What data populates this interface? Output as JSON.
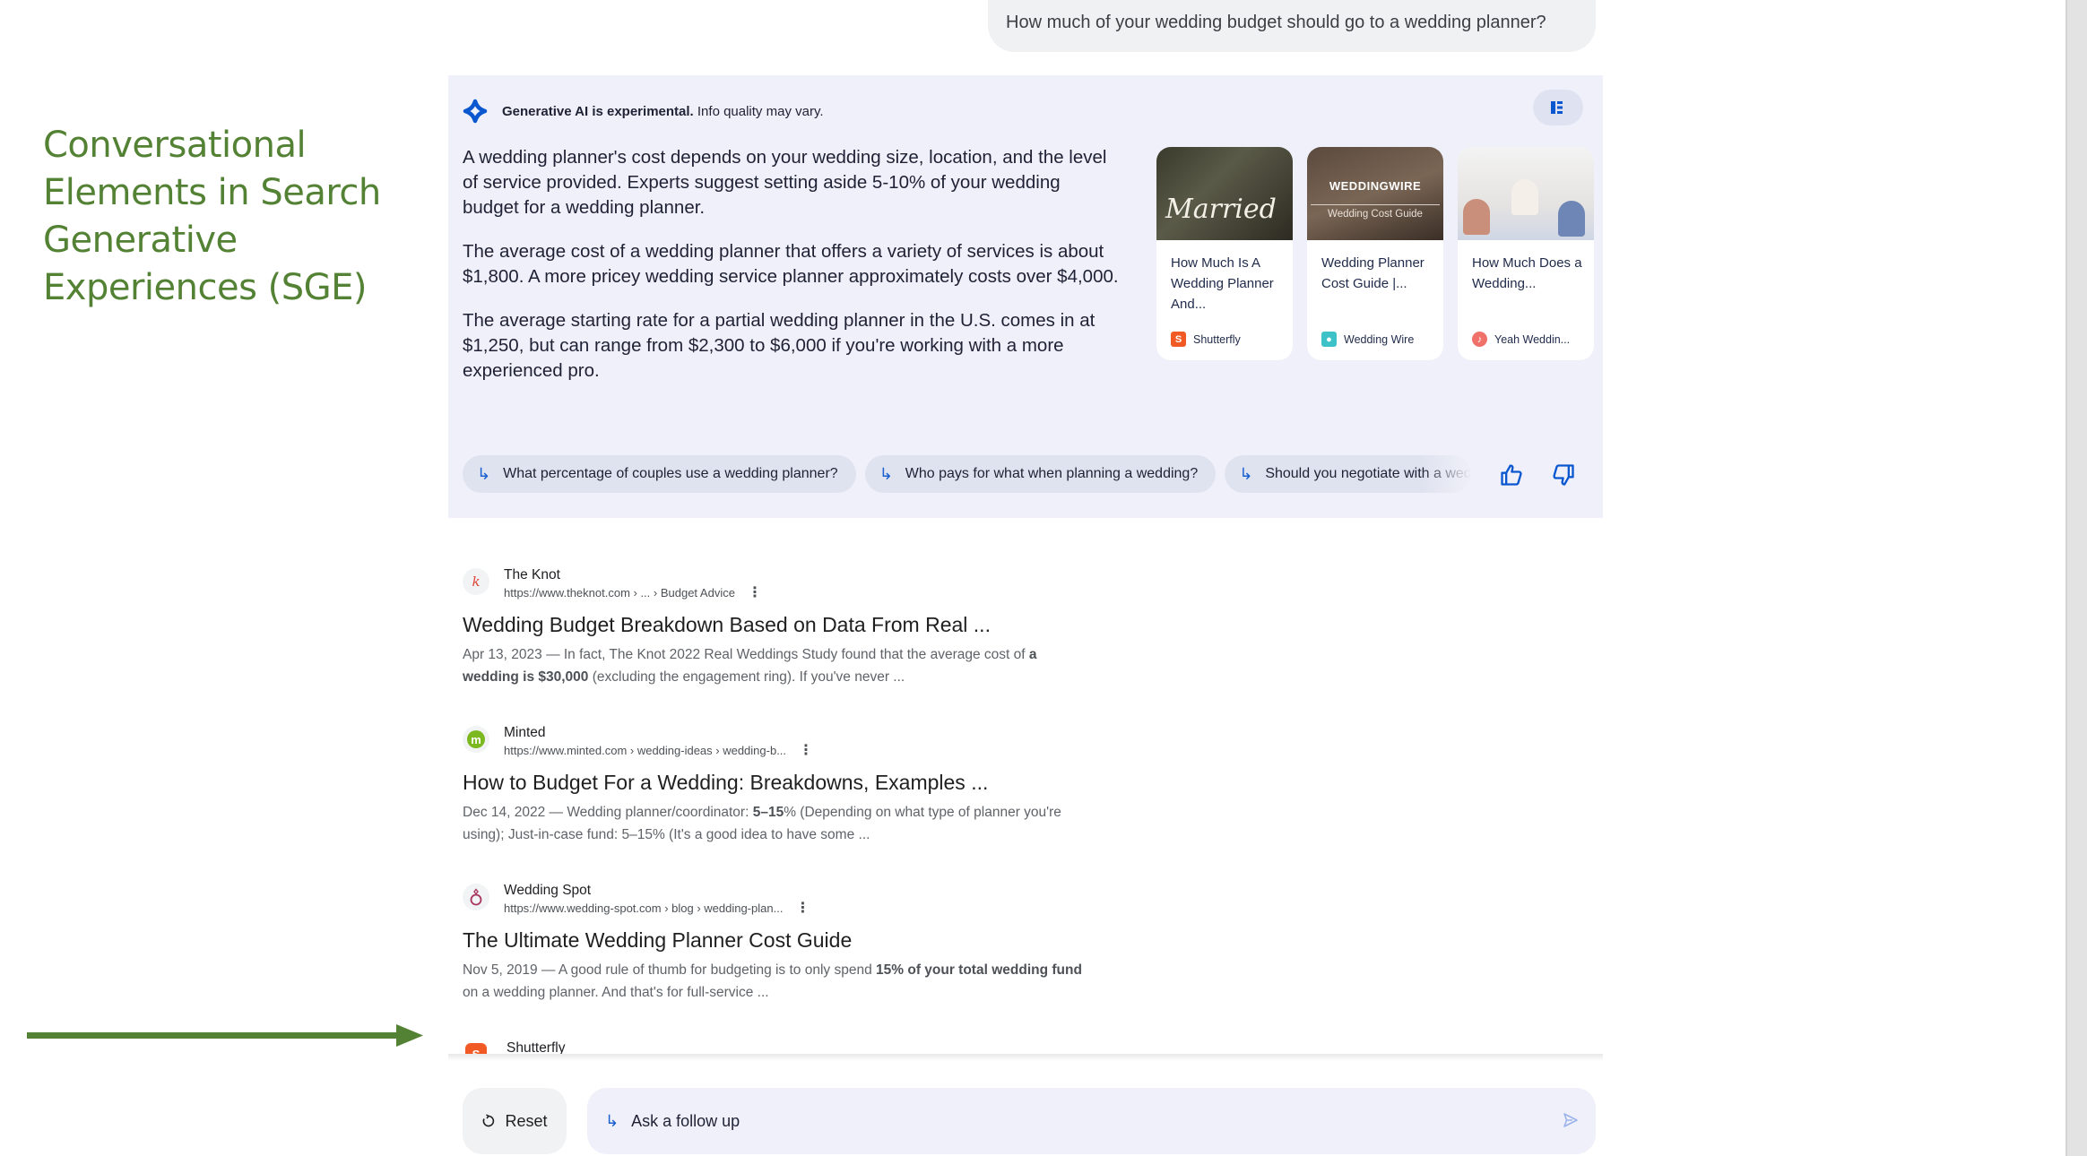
{
  "annotation": {
    "title": "Conversational Elements in Search Generative Experiences (SGE)",
    "color": "#548235"
  },
  "query": "How much of your wedding budget should go to a wedding planner?",
  "sge": {
    "disclaimer_bold": "Generative AI is experimental.",
    "disclaimer_rest": " Info quality may vary.",
    "layout_toggle_icon": "layout-panel-icon",
    "paragraphs": [
      "A wedding planner's cost depends on your wedding size, location, and the level of service provided. Experts suggest setting aside 5-10% of your wedding budget for a wedding planner.",
      "The average cost of a wedding planner that offers a variety of services is about $1,800. A more pricey wedding service planner approximately costs over $4,000.",
      "The average starting rate for a partial wedding planner in the U.S. comes in at $1,250, but can range from $2,300 to $6,000 if you're working with a more experienced pro."
    ],
    "cards": [
      {
        "title": "How Much Is A Wedding Planner And...",
        "source": "Shutterfly",
        "image_text": "Married",
        "source_color": "#f15a24",
        "source_letter": "S"
      },
      {
        "title": "Wedding Planner Cost Guide |...",
        "source": "Wedding Wire",
        "image_text": "WEDDINGWIRE",
        "image_subtext": "Wedding Cost Guide",
        "source_color": "#3cc2c7",
        "source_letter": ""
      },
      {
        "title": "How Much Does a Wedding...",
        "source": "Yeah Weddin...",
        "source_color": "#f0706a",
        "source_letter": ""
      }
    ],
    "follow_up_chips": [
      "What percentage of couples use a wedding planner?",
      "Who pays for what when planning a wedding?",
      "Should you negotiate with a wedding planner?"
    ],
    "feedback": {
      "thumbs_up": "thumbs-up-icon",
      "thumbs_down": "thumbs-down-icon"
    },
    "accent_color": "#1a5fd0"
  },
  "results": [
    {
      "site": "The Knot",
      "url": "https://www.theknot.com › ... › Budget Advice",
      "favicon_letter": "k",
      "title": "Wedding Budget Breakdown Based on Data From Real ...",
      "date": "Apr 13, 2023",
      "snippet_pre": " — In fact, The Knot 2022 Real Weddings Study found that the average cost of ",
      "snippet_bold": "a wedding is $30,000",
      "snippet_post": " (excluding the engagement ring). If you've never ..."
    },
    {
      "site": "Minted",
      "url": "https://www.minted.com › wedding-ideas › wedding-b...",
      "favicon_letter": "m",
      "title": "How to Budget For a Wedding: Breakdowns, Examples ...",
      "date": "Dec 14, 2022",
      "snippet_pre": " — Wedding planner/coordinator: ",
      "snippet_bold": "5–15",
      "snippet_post": "% (Depending on what type of planner you're using); Just-in-case fund: 5–15% (It's a good idea to have some ..."
    },
    {
      "site": "Wedding Spot",
      "url": "https://www.wedding-spot.com › blog › wedding-plan...",
      "favicon_letter": "ring",
      "title": "The Ultimate Wedding Planner Cost Guide",
      "date": "Nov 5, 2019",
      "snippet_pre": " — A good rule of thumb for budgeting is to only spend ",
      "snippet_bold": "15% of your total wedding fund",
      "snippet_post": " on a wedding planner. And that's for full-service ..."
    },
    {
      "site": "Shutterfly",
      "favicon_letter": "S"
    }
  ],
  "bottom_bar": {
    "reset_label": "Reset",
    "followup_placeholder": "Ask a follow up"
  }
}
